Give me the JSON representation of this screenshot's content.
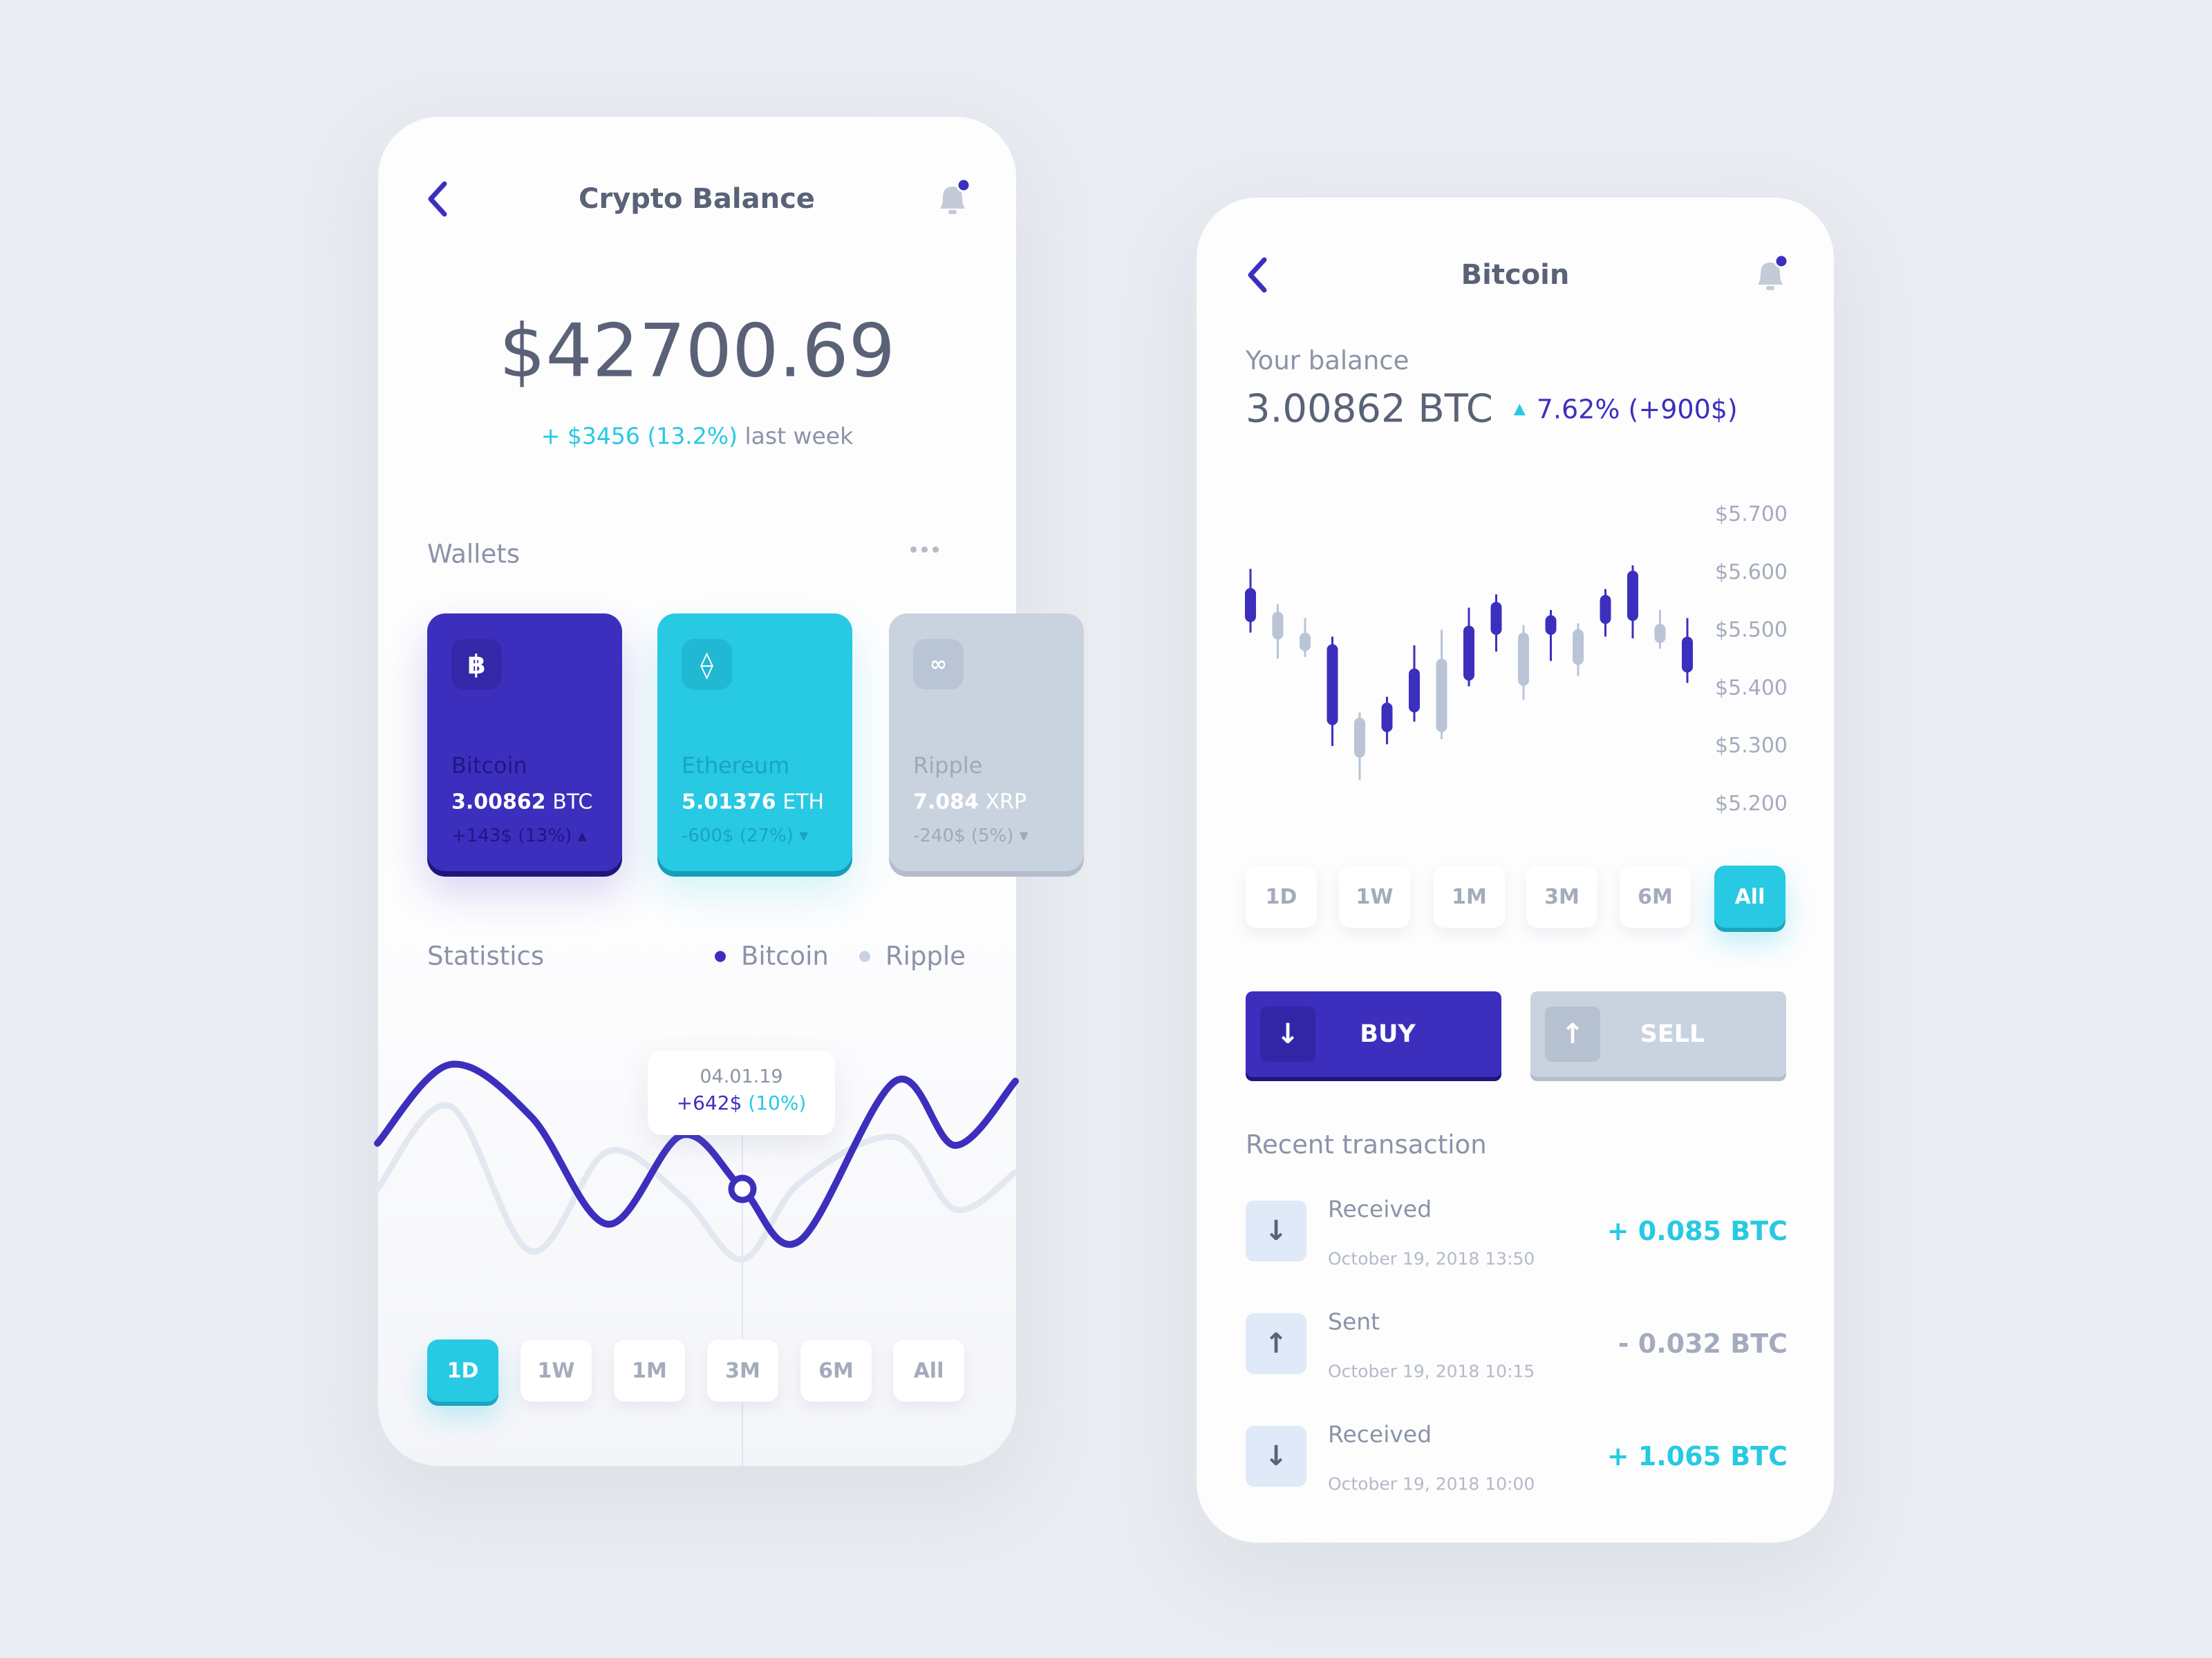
{
  "colors": {
    "primary": "#3d2fbd",
    "accent": "#27c9e3",
    "muted": "#c9d3e0",
    "background": "#e9ecf1"
  },
  "balance_screen": {
    "back_icon": "chevron-left-icon",
    "title": "Crypto Balance",
    "notification_icon": "bell-icon",
    "total": "$42700.69",
    "change": "+ $3456 (13.2%)",
    "change_suffix": "last week",
    "wallets_label": "Wallets",
    "more_icon": "more-dots-icon",
    "wallets": [
      {
        "name": "Bitcoin",
        "amount": "3.00862",
        "unit": "BTC",
        "change": "+143$ (13%)",
        "trend": "up",
        "icon": "bitcoin-icon"
      },
      {
        "name": "Ethereum",
        "amount": "5.01376",
        "unit": "ETH",
        "change": "-600$ (27%)",
        "trend": "down",
        "icon": "ethereum-icon"
      },
      {
        "name": "Ripple",
        "amount": "7.084",
        "unit": "XRP",
        "change": "-240$ (5%)",
        "trend": "down",
        "icon": "ripple-icon"
      }
    ],
    "statistics_label": "Statistics",
    "legend": [
      "Bitcoin",
      "Ripple"
    ],
    "tooltip": {
      "date": "04.01.19",
      "value": "+642$",
      "percent": "(10%)"
    },
    "ranges": [
      "1D",
      "1W",
      "1M",
      "3M",
      "6M",
      "All"
    ],
    "active_range": "1D"
  },
  "bitcoin_screen": {
    "back_icon": "chevron-left-icon",
    "title": "Bitcoin",
    "notification_icon": "bell-icon",
    "balance_label": "Your balance",
    "balance": "3.00862 BTC",
    "change": "7.62% (+900$)",
    "ranges": [
      "1D",
      "1W",
      "1M",
      "3M",
      "6M",
      "All"
    ],
    "active_range": "All",
    "buy_label": "BUY",
    "sell_label": "SELL",
    "recent_label": "Recent transaction",
    "transactions": [
      {
        "type": "Received",
        "date": "October 19, 2018 13:50",
        "amount": "+ 0.085 BTC",
        "direction": "in"
      },
      {
        "type": "Sent",
        "date": "October 19, 2018 10:15",
        "amount": "- 0.032 BTC",
        "direction": "out"
      },
      {
        "type": "Received",
        "date": "October 19, 2018 10:00",
        "amount": "+ 1.065 BTC",
        "direction": "in"
      }
    ]
  },
  "chart_data": [
    {
      "type": "line",
      "legend_placement": "top-right",
      "grid": false,
      "series": [
        {
          "name": "Bitcoin",
          "values": [
            58,
            96,
            71,
            19,
            62,
            36,
            11,
            88,
            57,
            88
          ]
        },
        {
          "name": "Ripple",
          "values": [
            36,
            76,
            6,
            54,
            32,
            2,
            39,
            61,
            26,
            44
          ]
        }
      ],
      "highlight": {
        "index": 5,
        "label": "04.01.19",
        "value": "+642$",
        "percent": "(10%)"
      }
    },
    {
      "type": "candlestick",
      "grid": false,
      "yticks": [
        "$5.700",
        "$5.600",
        "$5.500",
        "$5.400",
        "$5.300",
        "$5.200"
      ],
      "ylim": [
        5200,
        5700
      ],
      "candles": [
        {
          "high": 5604,
          "top": 5571,
          "bottom": 5512,
          "low": 5494,
          "color": "primary"
        },
        {
          "high": 5543,
          "top": 5530,
          "bottom": 5482,
          "low": 5449,
          "color": "muted"
        },
        {
          "high": 5519,
          "top": 5494,
          "bottom": 5462,
          "low": 5452,
          "color": "muted"
        },
        {
          "high": 5487,
          "top": 5474,
          "bottom": 5334,
          "low": 5298,
          "color": "primary"
        },
        {
          "high": 5356,
          "top": 5347,
          "bottom": 5278,
          "low": 5239,
          "color": "muted"
        },
        {
          "high": 5383,
          "top": 5373,
          "bottom": 5322,
          "low": 5301,
          "color": "primary"
        },
        {
          "high": 5472,
          "top": 5432,
          "bottom": 5356,
          "low": 5340,
          "color": "primary"
        },
        {
          "high": 5499,
          "top": 5449,
          "bottom": 5322,
          "low": 5310,
          "color": "muted"
        },
        {
          "high": 5537,
          "top": 5506,
          "bottom": 5411,
          "low": 5401,
          "color": "primary"
        },
        {
          "high": 5560,
          "top": 5547,
          "bottom": 5490,
          "low": 5461,
          "color": "primary"
        },
        {
          "high": 5507,
          "top": 5494,
          "bottom": 5402,
          "low": 5378,
          "color": "muted"
        },
        {
          "high": 5533,
          "top": 5524,
          "bottom": 5490,
          "low": 5445,
          "color": "primary"
        },
        {
          "high": 5510,
          "top": 5500,
          "bottom": 5438,
          "low": 5419,
          "color": "muted"
        },
        {
          "high": 5569,
          "top": 5559,
          "bottom": 5509,
          "low": 5487,
          "color": "primary"
        },
        {
          "high": 5610,
          "top": 5601,
          "bottom": 5514,
          "low": 5484,
          "color": "primary"
        },
        {
          "high": 5533,
          "top": 5509,
          "bottom": 5476,
          "low": 5466,
          "color": "muted"
        },
        {
          "high": 5519,
          "top": 5487,
          "bottom": 5425,
          "low": 5407,
          "color": "primary"
        }
      ]
    }
  ]
}
